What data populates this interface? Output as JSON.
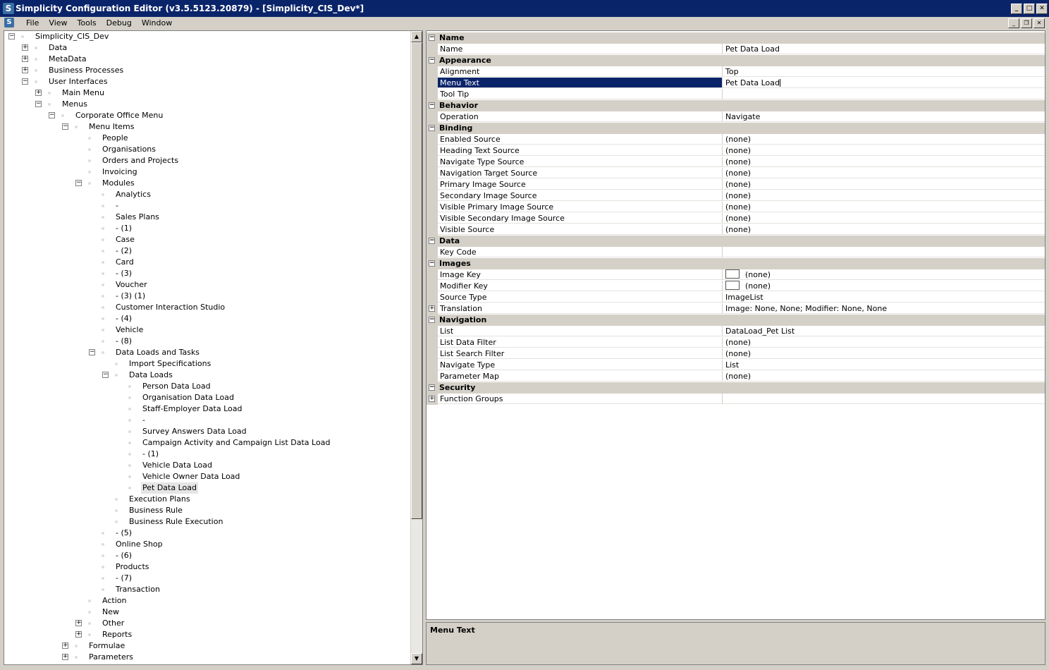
{
  "window": {
    "title": "Simplicity Configuration Editor (v3.5.5123.20879) - [Simplicity_CIS_Dev*]",
    "icon_letter": "S"
  },
  "menubar": {
    "items": [
      "File",
      "View",
      "Tools",
      "Debug",
      "Window"
    ]
  },
  "tree": {
    "nodes": [
      {
        "label": "Simplicity_CIS_Dev",
        "depth": 0,
        "expander": "minus"
      },
      {
        "label": "Data",
        "depth": 1,
        "expander": "plus"
      },
      {
        "label": "MetaData",
        "depth": 1,
        "expander": "plus"
      },
      {
        "label": "Business Processes",
        "depth": 1,
        "expander": "plus"
      },
      {
        "label": "User Interfaces",
        "depth": 1,
        "expander": "minus"
      },
      {
        "label": "Main Menu",
        "depth": 2,
        "expander": "plus"
      },
      {
        "label": "Menus",
        "depth": 2,
        "expander": "minus"
      },
      {
        "label": "Corporate Office Menu",
        "depth": 3,
        "expander": "minus"
      },
      {
        "label": "Menu Items",
        "depth": 4,
        "expander": "minus"
      },
      {
        "label": "People",
        "depth": 5,
        "expander": ""
      },
      {
        "label": "Organisations",
        "depth": 5,
        "expander": ""
      },
      {
        "label": "Orders and Projects",
        "depth": 5,
        "expander": ""
      },
      {
        "label": "Invoicing",
        "depth": 5,
        "expander": ""
      },
      {
        "label": "Modules",
        "depth": 5,
        "expander": "minus"
      },
      {
        "label": "Analytics",
        "depth": 6,
        "expander": ""
      },
      {
        "label": "-",
        "depth": 6,
        "expander": ""
      },
      {
        "label": "Sales Plans",
        "depth": 6,
        "expander": ""
      },
      {
        "label": "- (1)",
        "depth": 6,
        "expander": ""
      },
      {
        "label": "Case",
        "depth": 6,
        "expander": ""
      },
      {
        "label": "- (2)",
        "depth": 6,
        "expander": ""
      },
      {
        "label": "Card",
        "depth": 6,
        "expander": ""
      },
      {
        "label": "- (3)",
        "depth": 6,
        "expander": ""
      },
      {
        "label": "Voucher",
        "depth": 6,
        "expander": ""
      },
      {
        "label": "- (3) (1)",
        "depth": 6,
        "expander": ""
      },
      {
        "label": "Customer Interaction Studio",
        "depth": 6,
        "expander": ""
      },
      {
        "label": "- (4)",
        "depth": 6,
        "expander": ""
      },
      {
        "label": "Vehicle",
        "depth": 6,
        "expander": ""
      },
      {
        "label": "- (8)",
        "depth": 6,
        "expander": ""
      },
      {
        "label": "Data Loads and Tasks",
        "depth": 6,
        "expander": "minus"
      },
      {
        "label": "Import Specifications",
        "depth": 7,
        "expander": ""
      },
      {
        "label": "Data Loads",
        "depth": 7,
        "expander": "minus"
      },
      {
        "label": "Person Data Load",
        "depth": 8,
        "expander": ""
      },
      {
        "label": "Organisation Data Load",
        "depth": 8,
        "expander": ""
      },
      {
        "label": "Staff-Employer Data Load",
        "depth": 8,
        "expander": ""
      },
      {
        "label": "-",
        "depth": 8,
        "expander": ""
      },
      {
        "label": "Survey Answers Data Load",
        "depth": 8,
        "expander": ""
      },
      {
        "label": "Campaign Activity and Campaign List Data Load",
        "depth": 8,
        "expander": ""
      },
      {
        "label": "- (1)",
        "depth": 8,
        "expander": ""
      },
      {
        "label": "Vehicle Data Load",
        "depth": 8,
        "expander": ""
      },
      {
        "label": "Vehicle Owner Data Load",
        "depth": 8,
        "expander": ""
      },
      {
        "label": "Pet Data Load",
        "depth": 8,
        "expander": "",
        "selected": true
      },
      {
        "label": "Execution Plans",
        "depth": 7,
        "expander": ""
      },
      {
        "label": "Business Rule",
        "depth": 7,
        "expander": ""
      },
      {
        "label": "Business Rule Execution",
        "depth": 7,
        "expander": ""
      },
      {
        "label": "- (5)",
        "depth": 6,
        "expander": ""
      },
      {
        "label": "Online Shop",
        "depth": 6,
        "expander": ""
      },
      {
        "label": "- (6)",
        "depth": 6,
        "expander": ""
      },
      {
        "label": "Products",
        "depth": 6,
        "expander": ""
      },
      {
        "label": "- (7)",
        "depth": 6,
        "expander": ""
      },
      {
        "label": "Transaction",
        "depth": 6,
        "expander": ""
      },
      {
        "label": "Action",
        "depth": 5,
        "expander": ""
      },
      {
        "label": "New",
        "depth": 5,
        "expander": ""
      },
      {
        "label": "Other",
        "depth": 5,
        "expander": "plus"
      },
      {
        "label": "Reports",
        "depth": 5,
        "expander": "plus"
      },
      {
        "label": "Formulae",
        "depth": 4,
        "expander": "plus"
      },
      {
        "label": "Parameters",
        "depth": 4,
        "expander": "plus"
      }
    ]
  },
  "properties": {
    "rows": [
      {
        "kind": "category",
        "label": "Name"
      },
      {
        "kind": "prop",
        "name": "Name",
        "value": "Pet Data Load"
      },
      {
        "kind": "category",
        "label": "Appearance"
      },
      {
        "kind": "prop",
        "name": "Alignment",
        "value": "Top"
      },
      {
        "kind": "prop",
        "name": "Menu Text",
        "value": "Pet Data Load",
        "selected": true,
        "editing": true
      },
      {
        "kind": "prop",
        "name": "Tool Tip",
        "value": ""
      },
      {
        "kind": "category",
        "label": "Behavior"
      },
      {
        "kind": "prop",
        "name": "Operation",
        "value": "Navigate"
      },
      {
        "kind": "category",
        "label": "Binding"
      },
      {
        "kind": "prop",
        "name": "Enabled Source",
        "value": "(none)"
      },
      {
        "kind": "prop",
        "name": "Heading Text Source",
        "value": "(none)"
      },
      {
        "kind": "prop",
        "name": "Navigate Type Source",
        "value": "(none)"
      },
      {
        "kind": "prop",
        "name": "Navigation Target Source",
        "value": "(none)"
      },
      {
        "kind": "prop",
        "name": "Primary Image Source",
        "value": "(none)"
      },
      {
        "kind": "prop",
        "name": "Secondary Image Source",
        "value": "(none)"
      },
      {
        "kind": "prop",
        "name": "Visible Primary Image Source",
        "value": "(none)"
      },
      {
        "kind": "prop",
        "name": "Visible Secondary Image Source",
        "value": "(none)"
      },
      {
        "kind": "prop",
        "name": "Visible Source",
        "value": "(none)"
      },
      {
        "kind": "category",
        "label": "Data"
      },
      {
        "kind": "prop",
        "name": "Key Code",
        "value": ""
      },
      {
        "kind": "category",
        "label": "Images"
      },
      {
        "kind": "prop",
        "name": "Image Key",
        "value": "(none)",
        "swatch": true
      },
      {
        "kind": "prop",
        "name": "Modifier Key",
        "value": "(none)",
        "swatch": true
      },
      {
        "kind": "prop",
        "name": "Source Type",
        "value": "ImageList"
      },
      {
        "kind": "prop",
        "name": "Translation",
        "value": "Image: None, None; Modifier: None, None",
        "expandable": true
      },
      {
        "kind": "category",
        "label": "Navigation"
      },
      {
        "kind": "prop",
        "name": "List",
        "value": "DataLoad_Pet List"
      },
      {
        "kind": "prop",
        "name": "List Data Filter",
        "value": "(none)"
      },
      {
        "kind": "prop",
        "name": "List Search Filter",
        "value": "(none)"
      },
      {
        "kind": "prop",
        "name": "Navigate Type",
        "value": "List"
      },
      {
        "kind": "prop",
        "name": "Parameter Map",
        "value": "(none)"
      },
      {
        "kind": "category",
        "label": "Security"
      },
      {
        "kind": "prop",
        "name": "Function Groups",
        "value": "",
        "expandable": true
      }
    ]
  },
  "description": {
    "title": "Menu Text"
  }
}
